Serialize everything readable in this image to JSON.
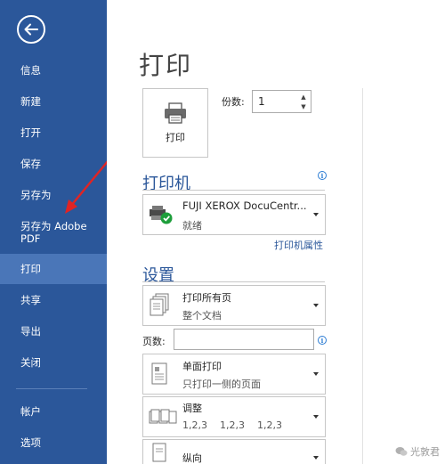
{
  "sidebar": {
    "items": [
      {
        "label": "信息"
      },
      {
        "label": "新建"
      },
      {
        "label": "打开"
      },
      {
        "label": "保存"
      },
      {
        "label": "另存为"
      },
      {
        "label": "另存为 Adobe PDF"
      },
      {
        "label": "打印",
        "active": true
      },
      {
        "label": "共享"
      },
      {
        "label": "导出"
      },
      {
        "label": "关闭"
      },
      {
        "label": "帐户"
      },
      {
        "label": "选项"
      }
    ]
  },
  "main": {
    "title": "打印",
    "print_button_label": "打印",
    "copies_label": "份数:",
    "copies_value": "1",
    "printer_heading": "打印机",
    "printer_name": "FUJI XEROX DocuCentr...",
    "printer_status": "就绪",
    "printer_properties": "打印机属性",
    "settings_heading": "设置",
    "range_title": "打印所有页",
    "range_sub": "整个文档",
    "pages_label": "页数:",
    "pages_value": "",
    "sides_title": "单面打印",
    "sides_sub": "只打印一侧的页面",
    "collate_title": "调整",
    "collate_sub": "1,2,3    1,2,3    1,2,3",
    "orientation_title": "纵向"
  },
  "watermark": "光敦君",
  "colors": {
    "sidebar_bg": "#2b579a",
    "sidebar_active": "#4a76b8",
    "heading_blue": "#2b579a",
    "annotation_arrow": "#e02424"
  },
  "icons": [
    "back-arrow-icon",
    "printer-icon",
    "printer-device-icon",
    "status-ok-icon",
    "info-icon",
    "pages-icon",
    "single-sided-icon",
    "collate-icon",
    "portrait-icon",
    "wechat-icon"
  ]
}
